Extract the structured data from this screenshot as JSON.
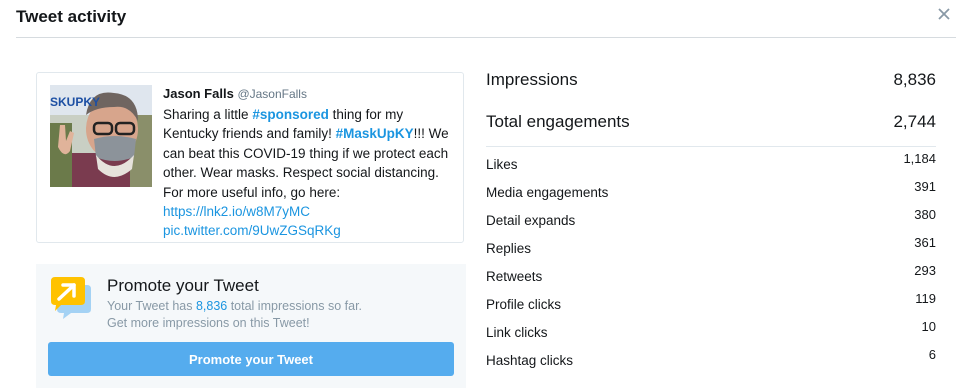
{
  "dialog": {
    "title": "Tweet activity"
  },
  "tweet": {
    "author_name": "Jason Falls",
    "author_handle": "@JasonFalls",
    "image_banner": "SKUPKY",
    "text_1": "Sharing a little ",
    "hashtag_1": "#sponsored",
    "text_2": " thing for my Kentucky friends and family! ",
    "hashtag_2": "#MaskUpKY",
    "text_3": "!!! We can beat this COVID-19 thing if we protect each other. Wear masks. Respect social distancing. For more useful info, go here: ",
    "link": "https://lnk2.io/w8M7yMC",
    "pic_link": "pic.twitter.com/9UwZGSqRKg"
  },
  "promo": {
    "title": "Promote your Tweet",
    "desc_before": "Your Tweet has ",
    "impressions": "8,836",
    "desc_after": " total impressions so far.",
    "desc_line2": "Get more impressions on this Tweet!",
    "button_label": "Promote your Tweet"
  },
  "stats": {
    "impressions_label": "Impressions",
    "impressions_value": "8,836",
    "engagements_label": "Total engagements",
    "engagements_value": "2,744",
    "rows": [
      {
        "label": "Likes",
        "value": "1,184"
      },
      {
        "label": "Media engagements",
        "value": "391"
      },
      {
        "label": "Detail expands",
        "value": "380"
      },
      {
        "label": "Replies",
        "value": "361"
      },
      {
        "label": "Retweets",
        "value": "293"
      },
      {
        "label": "Profile clicks",
        "value": "119"
      },
      {
        "label": "Link clicks",
        "value": "10"
      },
      {
        "label": "Hashtag clicks",
        "value": "6"
      }
    ]
  },
  "colors": {
    "link_blue": "#1b95e0",
    "button_blue": "#55acee",
    "promo_bg": "#f5f8fa",
    "icon_yellow": "#ffc200",
    "icon_blue": "#a4d2f4"
  },
  "icons": {
    "close": "close-icon",
    "promote": "promote-arrow-icon"
  }
}
